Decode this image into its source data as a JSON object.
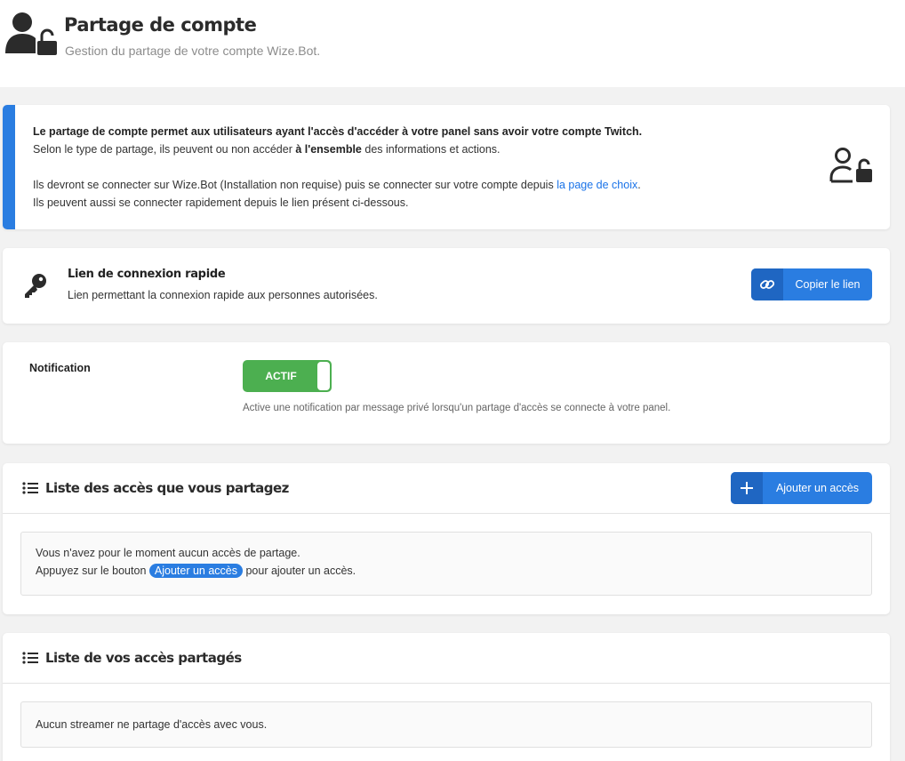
{
  "header": {
    "title": "Partage de compte",
    "subtitle": "Gestion du partage de votre compte Wize.Bot."
  },
  "info": {
    "line1_bold": "Le partage de compte permet aux utilisateurs ayant l'accès d'accéder à votre panel sans avoir votre compte Twitch.",
    "line2_pre": "Selon le type de partage, ils peuvent ou non accéder ",
    "line2_bold": "à l'ensemble",
    "line2_post": " des informations et actions.",
    "line3_pre": "Ils devront se connecter sur Wize.Bot (Installation non requise) puis se connecter sur votre compte depuis ",
    "line3_link": "la page de choix",
    "line3_post": ".",
    "line4": "Ils peuvent aussi se connecter rapidement depuis le lien présent ci-dessous."
  },
  "quick_link": {
    "title": "Lien de connexion rapide",
    "description": "Lien permettant la connexion rapide aux personnes autorisées.",
    "button_label": "Copier le lien"
  },
  "notification": {
    "label": "Notification",
    "toggle_label": "ACTIF",
    "toggle_on": true,
    "description": "Active une notification par message privé lorsqu'un partage d'accès se connecte à votre panel."
  },
  "shared_list": {
    "title": "Liste des accès que vous partagez",
    "add_button_label": "Ajouter un accès",
    "empty_line1": "Vous n'avez pour le moment aucun accès de partage.",
    "empty_line2_pre": "Appuyez sur le bouton ",
    "empty_line2_pill": "Ajouter un accès",
    "empty_line2_post": " pour ajouter un accès."
  },
  "received_list": {
    "title": "Liste de vos accès partagés",
    "empty_text": "Aucun streamer ne partage d'accès avec vous."
  },
  "colors": {
    "accent": "#2a7de1",
    "toggle_on": "#4caf50"
  },
  "icons": [
    "user-lock-icon",
    "key-icon",
    "link-icon",
    "list-icon",
    "plus-icon"
  ]
}
